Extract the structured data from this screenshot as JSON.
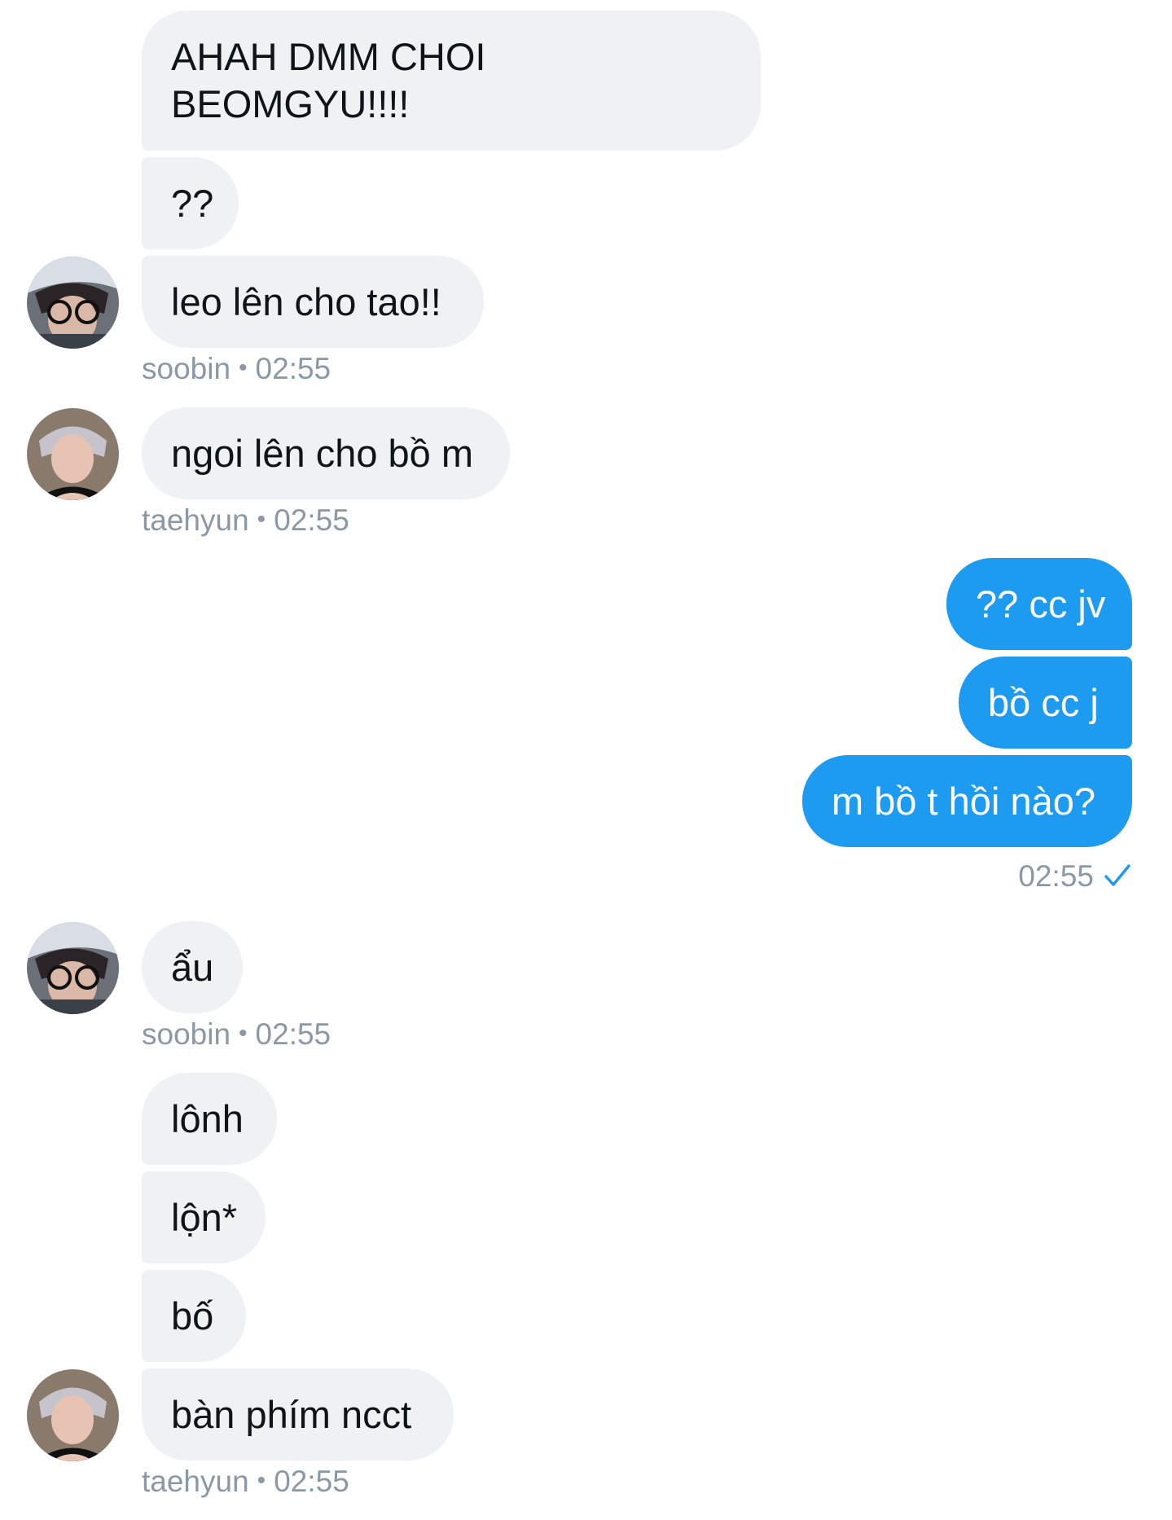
{
  "colors": {
    "incoming_bubble": "#eff1f3",
    "outgoing_bubble": "#1d9bf0",
    "meta_text": "#8b98a5",
    "check": "#1d9bf0"
  },
  "icons": {
    "read_receipt": "check-icon"
  },
  "messages": [
    {
      "id": "m1",
      "direction": "in",
      "lines": [
        "AHAH DMM CHOI",
        "BEOMGYU!!!!"
      ]
    },
    {
      "id": "m2",
      "direction": "in",
      "text": "??"
    },
    {
      "id": "m3",
      "direction": "in",
      "text": "leo lên cho tao!!",
      "sender": "soobin",
      "time": "02:55",
      "avatar": "soobin"
    },
    {
      "id": "m4",
      "direction": "in",
      "text": "ngoi lên cho bồ m",
      "sender": "taehyun",
      "time": "02:55",
      "avatar": "taehyun"
    },
    {
      "id": "m5",
      "direction": "out",
      "text": "?? cc jv"
    },
    {
      "id": "m6",
      "direction": "out",
      "text": "bồ cc j"
    },
    {
      "id": "m7",
      "direction": "out",
      "text": "m bồ t hồi nào?",
      "time": "02:55"
    },
    {
      "id": "m8",
      "direction": "in",
      "text": "ẩu",
      "sender": "soobin",
      "time": "02:55",
      "avatar": "soobin"
    },
    {
      "id": "m9",
      "direction": "in",
      "text": "lônh"
    },
    {
      "id": "m10",
      "direction": "in",
      "text": "lộn*"
    },
    {
      "id": "m11",
      "direction": "in",
      "text": "bố"
    },
    {
      "id": "m12",
      "direction": "in",
      "text": "bàn phím ncct",
      "sender": "taehyun",
      "time": "02:55",
      "avatar": "taehyun"
    }
  ],
  "separator": "•"
}
